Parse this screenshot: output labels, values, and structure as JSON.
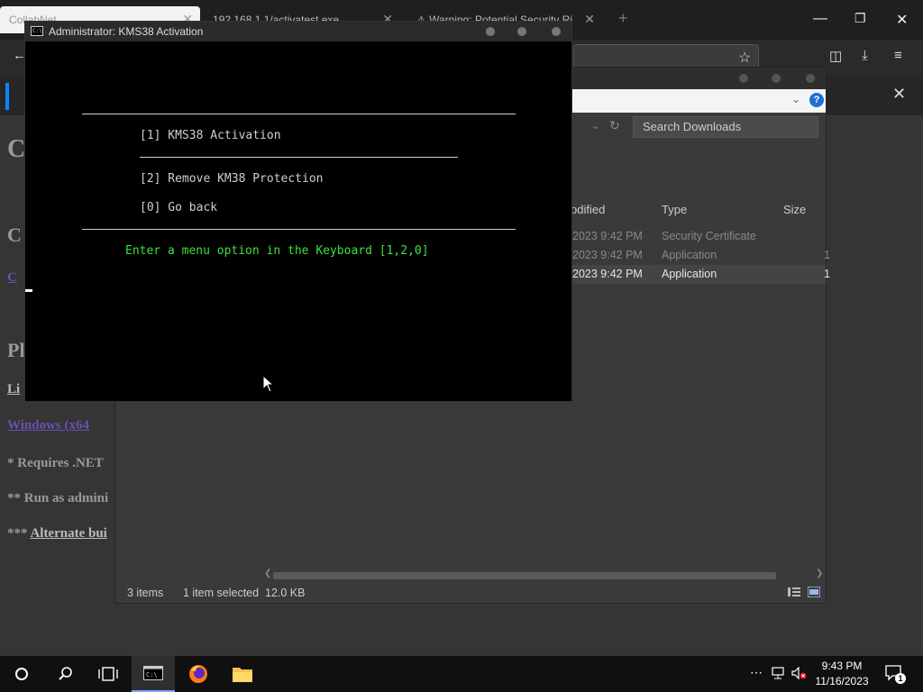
{
  "browser": {
    "tabs": [
      {
        "label": "CollabNet"
      },
      {
        "label": "192.168.1.1/activatest.exe"
      },
      {
        "label": "Warning: Potential Security Ri"
      }
    ],
    "new_tab_label": "+",
    "page": {
      "heading1": "C",
      "heading2": "C",
      "link1": "C",
      "heading3": "Pl",
      "section": "Li",
      "link2": "Windows (x64",
      "note1": "* Requires .NET",
      "note2": "** Run as admini",
      "note3_prefix": "***",
      "note3_link": "Alternate bui"
    }
  },
  "library": {
    "search_placeholder": "Search Downloads",
    "columns": {
      "modified": "odified",
      "type": "Type",
      "size": "Size"
    },
    "rows": [
      {
        "modified": "2023 9:42 PM",
        "type": "Security Certificate",
        "size": ""
      },
      {
        "modified": "2023 9:42 PM",
        "type": "Application",
        "size": "1"
      },
      {
        "modified": "2023 9:42 PM",
        "type": "Application",
        "size": "1"
      }
    ],
    "status": {
      "items": "3 items",
      "selected": "1 item selected",
      "size": "12.0 KB"
    }
  },
  "console": {
    "title": "Administrator:  KMS38 Activation",
    "icon_text": "C:\\",
    "options": [
      "[1] KMS38 Activation",
      "[2] Remove KM38 Protection",
      "[0] Go back"
    ],
    "prompt": "Enter a menu option in the Keyboard [1,2,0]"
  },
  "taskbar": {
    "time": "9:43 PM",
    "date": "11/16/2023",
    "notification_count": "1",
    "apps": [
      "start-icon",
      "search-icon",
      "task-view-icon",
      "terminal-icon",
      "firefox-icon",
      "file-explorer-icon"
    ]
  },
  "colors": {
    "console_prompt": "#3ee03e",
    "help_badge": "#1f6fd6",
    "notification_accent": "#0a84ff"
  }
}
